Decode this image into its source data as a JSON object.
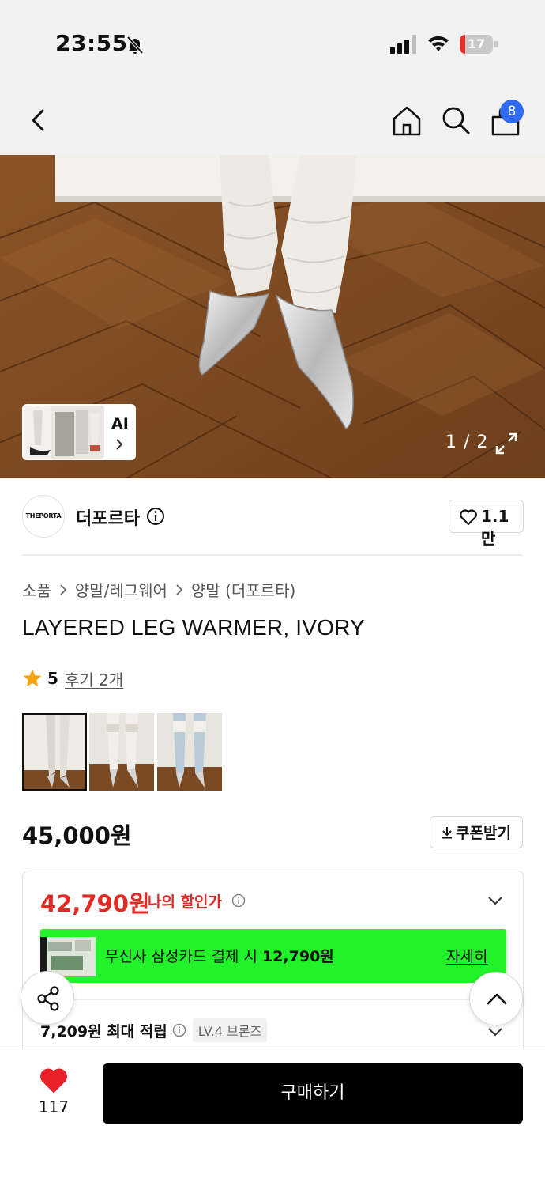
{
  "status_bar": {
    "time": "23:55",
    "battery_level": "17",
    "battery_fraction": 0.17,
    "colors": {
      "battery_low": "#e5302c"
    }
  },
  "header": {
    "cart_count": "8",
    "icons": [
      "back-icon",
      "home-icon",
      "search-icon",
      "cart-icon"
    ],
    "colors": {
      "badge": "#2f6bf0"
    }
  },
  "gallery": {
    "ai_label": "AI",
    "page_indicator": "1 / 2"
  },
  "brand": {
    "logo_text": "THEPORTA",
    "name": "더포르타",
    "likes": "1.1만"
  },
  "breadcrumb": [
    "소품",
    "양말/레그웨어",
    "양말 (더포르타)"
  ],
  "product": {
    "title": "LAYERED LEG WARMER, IVORY",
    "rating": "5",
    "review_link": "후기 2개",
    "price": "45,000원",
    "coupon_label": "쿠폰받기"
  },
  "discount": {
    "price": "42,790원",
    "label": "나의 할인가",
    "promo_text": "무신사 삼성카드 결제 시 ",
    "promo_amount": "12,790원",
    "promo_link": "자세히",
    "points_text": "7,209원 최대 적립",
    "level_badge": "LV.4 브론즈",
    "colors": {
      "discount": "#e02a24",
      "promo_bg": "#22f22a"
    }
  },
  "bottom_bar": {
    "wish_count": "117",
    "buy_label": "구매하기",
    "colors": {
      "heart": "#e8202a",
      "buy_bg": "#000000"
    }
  }
}
